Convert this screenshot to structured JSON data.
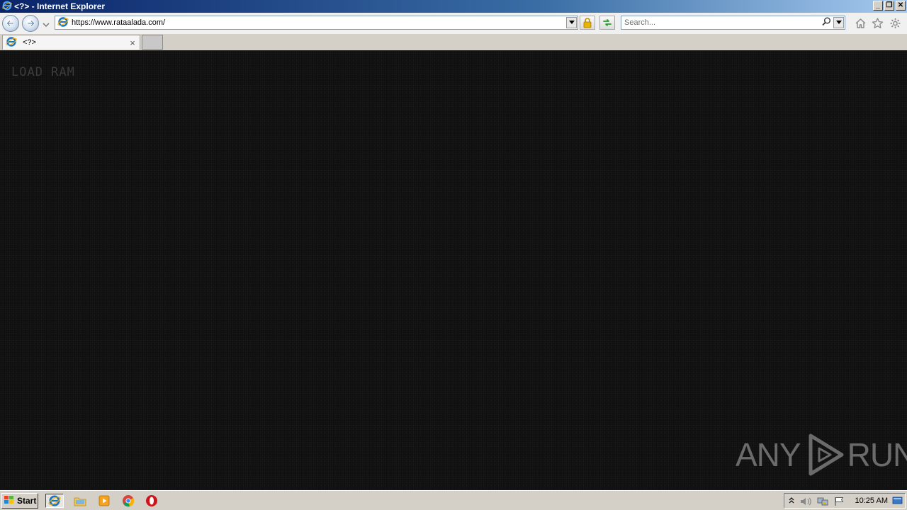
{
  "window": {
    "title": "<?> - Internet Explorer",
    "min_label": "_",
    "max_label": "❐",
    "close_label": "✕"
  },
  "navbar": {
    "url": "https://www.rataalada.com/",
    "search_placeholder": "Search..."
  },
  "tabs": [
    {
      "label": "<?>",
      "close_label": "×",
      "active": true
    }
  ],
  "page": {
    "text": "LOAD RAM",
    "background_color": "#0f0f0f",
    "text_color": "#3c3c3c"
  },
  "watermark": {
    "left_text": "ANY",
    "right_text": "RUN"
  },
  "taskbar": {
    "start_label": "Start",
    "pinned": [
      "internet-explorer-icon",
      "file-explorer-icon",
      "media-player-icon",
      "chrome-icon",
      "opera-icon"
    ],
    "clock": "10:25 AM"
  },
  "colors": {
    "titlebar_start": "#0a246a",
    "titlebar_end": "#a6caf0",
    "ie_blue": "#1e73be"
  }
}
